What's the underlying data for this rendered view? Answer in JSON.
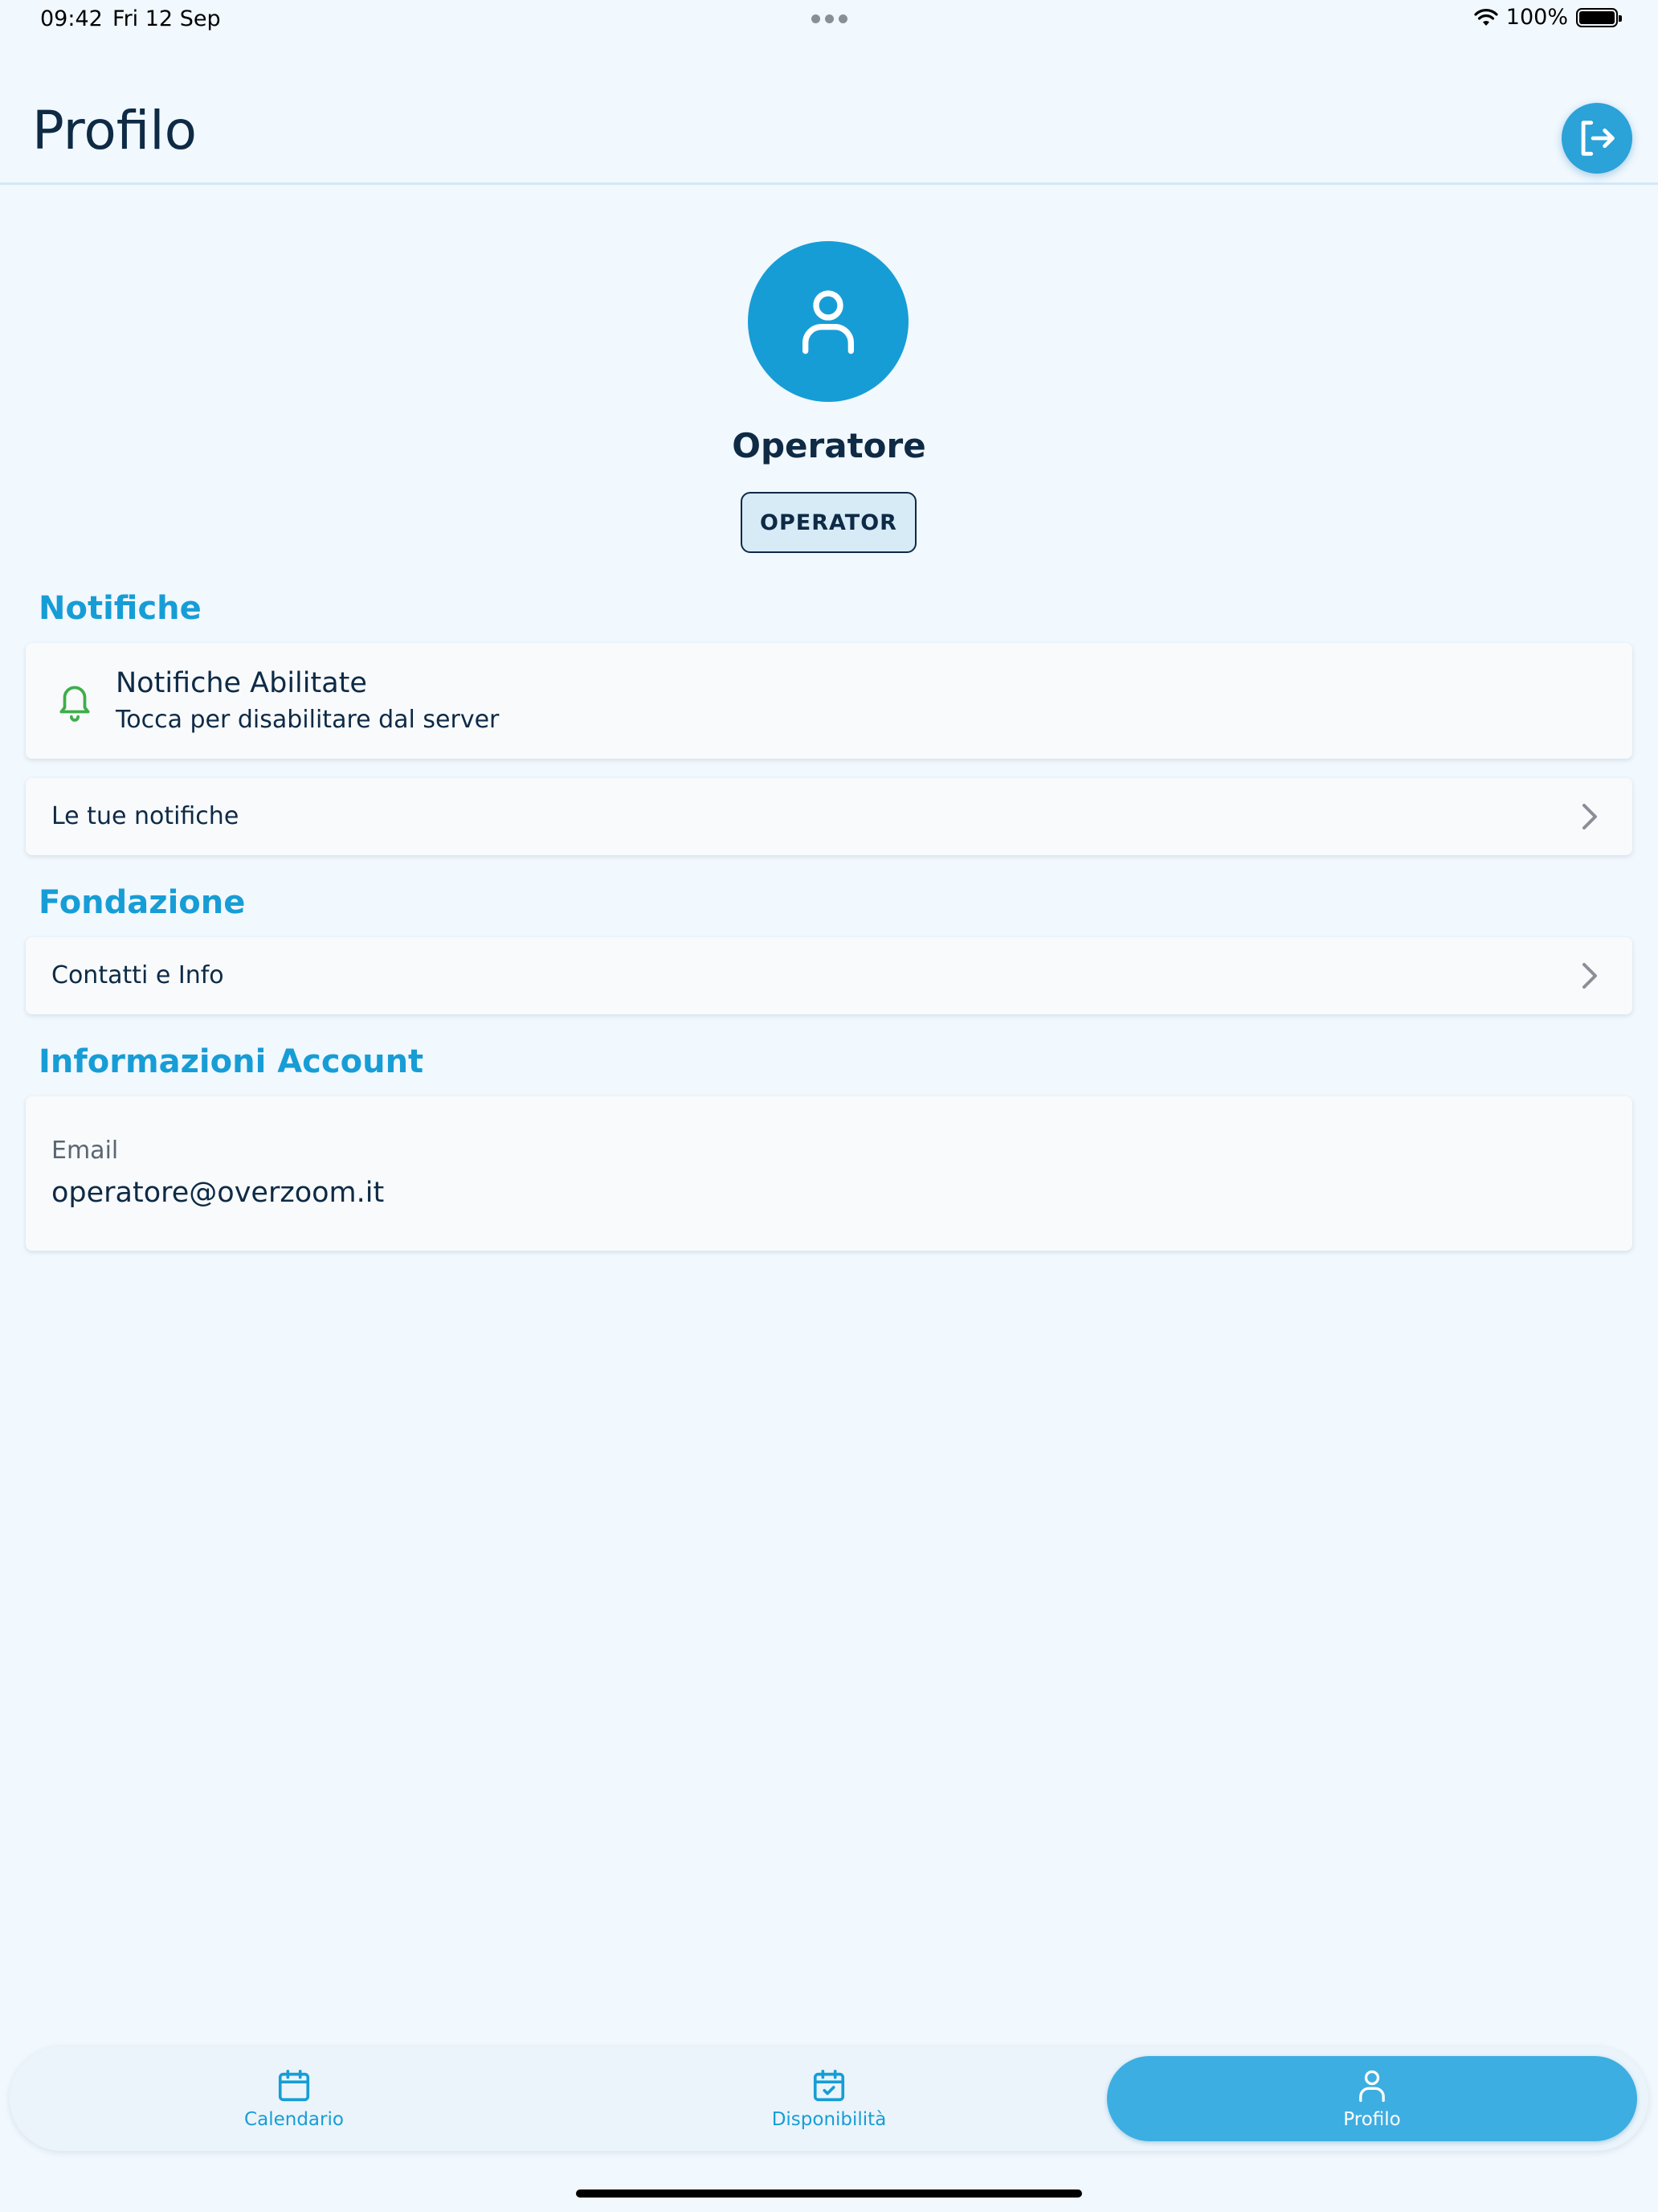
{
  "status_bar": {
    "time": "09:42",
    "date": "Fri 12 Sep",
    "battery": "100%",
    "battery_level": 1.0
  },
  "header": {
    "title": "Profilo",
    "logout_icon": "logout-icon"
  },
  "profile": {
    "avatar_icon": "user-icon",
    "name": "Operatore",
    "role": "OPERATOR"
  },
  "sections": {
    "notifications": {
      "title": "Notifiche",
      "status_icon": "bell-icon",
      "status_title": "Notifiche Abilitate",
      "status_subtitle": "Tocca per disabilitare dal server",
      "list_label": "Le tue notifiche"
    },
    "foundation": {
      "title": "Fondazione",
      "contacts_label": "Contatti e Info"
    },
    "account": {
      "title": "Informazioni Account",
      "email_label": "Email",
      "email_value": "operatore@overzoom.it"
    }
  },
  "tabs": [
    {
      "label": "Calendario",
      "icon": "calendar-icon",
      "active": false
    },
    {
      "label": "Disponibilità",
      "icon": "calendar-check-icon",
      "active": false
    },
    {
      "label": "Profilo",
      "icon": "user-icon",
      "active": true
    }
  ],
  "colors": {
    "accent": "#179dd6",
    "active_tab": "#3daee1",
    "text": "#0e2a45",
    "success": "#3dae4a",
    "background": "#f1f8fe"
  }
}
